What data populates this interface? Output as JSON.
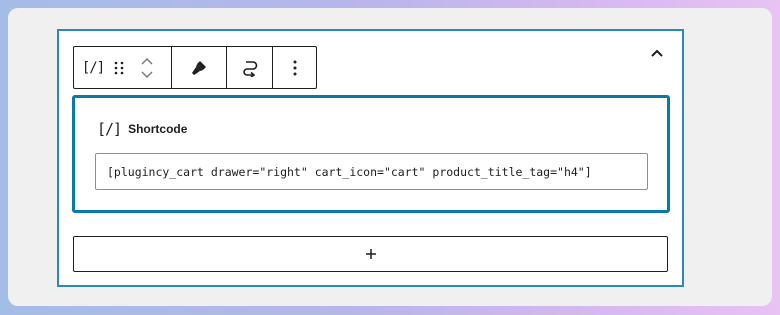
{
  "toolbar": {
    "block_type_icon": "shortcode-icon",
    "drag_icon": "drag-handle-icon",
    "move_up_icon": "chevron-up-icon",
    "move_down_icon": "chevron-down-icon",
    "style_icon": "paintbrush-icon",
    "transform_icon": "transform-icon",
    "options_icon": "more-vertical-icon"
  },
  "collapse_icon": "chevron-up-icon",
  "shortcode": {
    "icon_text": "[/]",
    "label": "Shortcode",
    "value": "[plugincy_cart drawer=\"right\" cart_icon=\"cart\" product_title_tag=\"h4\"]"
  },
  "appender": {
    "icon": "plus-icon"
  },
  "colors": {
    "accent": "#0b79a8",
    "frame": "#2a89b8",
    "text": "#1e1e1e"
  }
}
